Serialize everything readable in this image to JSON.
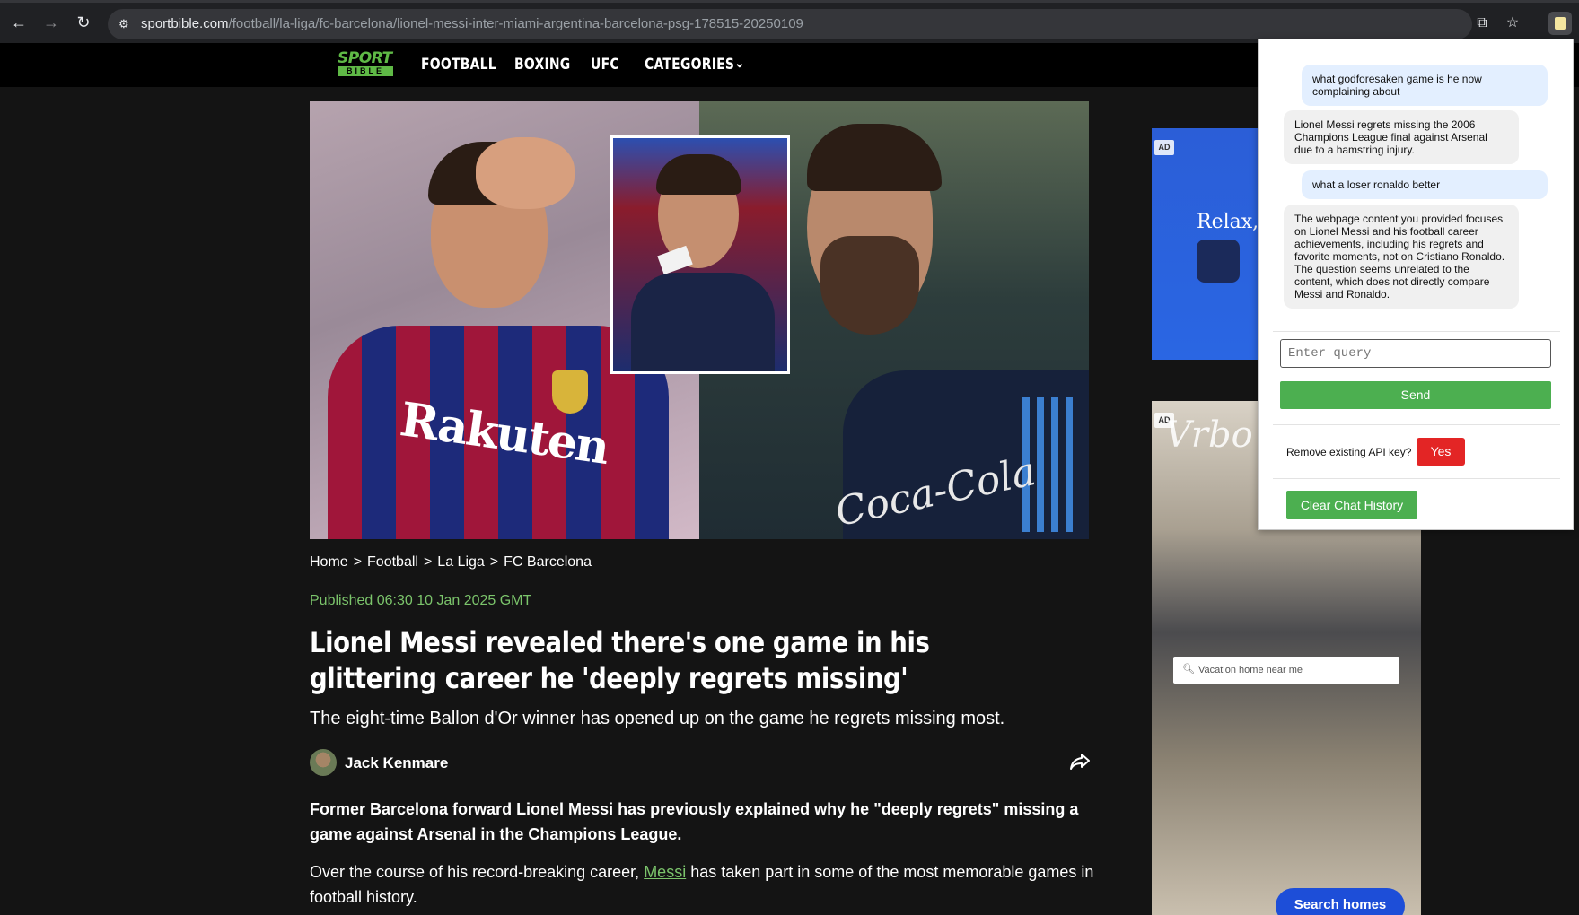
{
  "browser": {
    "url_domain": "sportbible.com",
    "url_path": "/football/la-liga/fc-barcelona/lionel-messi-inter-miami-argentina-barcelona-psg-178515-20250109"
  },
  "site": {
    "logo_top": "SPORT",
    "logo_bottom": "BIBLE",
    "nav": [
      "FOOTBALL",
      "BOXING",
      "UFC",
      "CATEGORIES"
    ]
  },
  "hero": {
    "shirt_sponsor": "Rakuten",
    "shirt_sponsor_right": "Coca-Cola"
  },
  "article": {
    "breadcrumb": [
      "Home",
      "Football",
      "La Liga",
      "FC Barcelona"
    ],
    "breadcrumb_sep": ">",
    "published": "Published 06:30 10 Jan 2025 GMT",
    "headline": "Lionel Messi revealed there's one game in his glittering career he 'deeply regrets missing'",
    "subheadline": "The eight-time Ballon d'Or winner has opened up on the game he regrets missing most.",
    "author": "Jack Kenmare",
    "lede": "Former Barcelona forward Lionel Messi has previously explained why he \"deeply regrets\" missing a game against Arsenal in the Champions League.",
    "body_before": "Over the course of his record-breaking career, ",
    "body_link": "Messi",
    "body_after": " has taken part in some of the most memorable games in football history."
  },
  "ads": {
    "label": "AD",
    "ad1_text": "Relax, y",
    "ad2_brand": "Vrbo",
    "ad2_search_placeholder": "Vacation home near me",
    "ad2_button": "Search homes"
  },
  "chat": {
    "messages": [
      {
        "role": "user",
        "text": "what godforesaken game is he now complaining about"
      },
      {
        "role": "bot",
        "text": "Lionel Messi regrets missing the 2006 Champions League final against Arsenal due to a hamstring injury."
      },
      {
        "role": "user",
        "text": "what a loser ronaldo better"
      },
      {
        "role": "bot",
        "text": "The webpage content you provided focuses on Lionel Messi and his football career achievements, including his regrets and favorite moments, not on Cristiano Ronaldo. The question seems unrelated to the content, which does not directly compare Messi and Ronaldo."
      }
    ],
    "input_placeholder": "Enter query",
    "send_label": "Send",
    "api_key_label": "Remove existing API key?",
    "yes_label": "Yes",
    "clear_label": "Clear Chat History"
  },
  "colors": {
    "accent_green": "#7bc46b",
    "button_green": "#4caf50",
    "danger_red": "#e32525"
  }
}
